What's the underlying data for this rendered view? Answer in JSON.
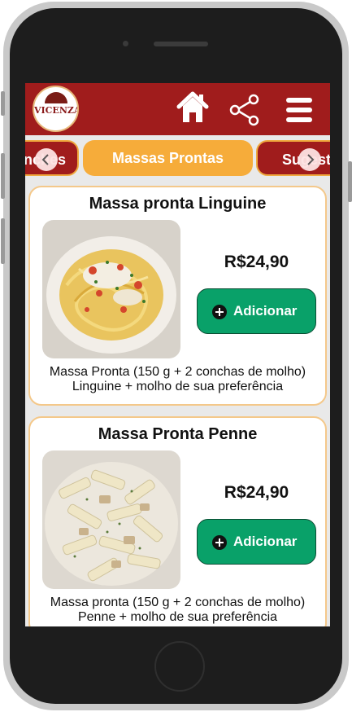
{
  "header": {
    "logo_text": "VICENZA",
    "home_icon": "home-icon",
    "share_icon": "share-icon",
    "menu_icon": "hamburger-menu-icon"
  },
  "categories": {
    "prev_label": "Lanches",
    "active_label": "Massas Prontas",
    "next_label": "Sugestões"
  },
  "products": [
    {
      "title": "Massa pronta Linguine",
      "price": "R$24,90",
      "button_label": "Adicionar",
      "desc_line1": "Massa Pronta (150 g + 2 conchas de molho)",
      "desc_line2": "Linguine + molho de sua preferência"
    },
    {
      "title": "Massa Pronta Penne",
      "price": "R$24,90",
      "button_label": "Adicionar",
      "desc_line1": "Massa pronta (150 g + 2 conchas de molho)",
      "desc_line2": "Penne + molho de sua preferência"
    }
  ],
  "colors": {
    "header_red": "#a01c1c",
    "accent_orange": "#f6ac3a",
    "button_green": "#09a169"
  }
}
